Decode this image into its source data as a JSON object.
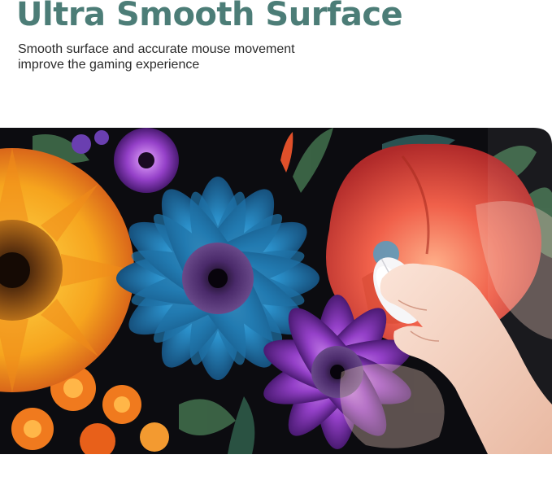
{
  "headline": "Ultra Smooth Surface",
  "description": "Smooth surface and accurate mouse movement improve the gaming experience",
  "colors": {
    "headline": "#4c7d77",
    "body_text": "#2b2b2b",
    "pad_background": "#0c0c10"
  },
  "product_image": {
    "subject": "floral-mousepad-with-hand-and-mouse",
    "motifs": [
      "sunflower",
      "blue-daisy",
      "red-poppy",
      "purple-daisy",
      "orange-marigolds",
      "leaves"
    ]
  }
}
